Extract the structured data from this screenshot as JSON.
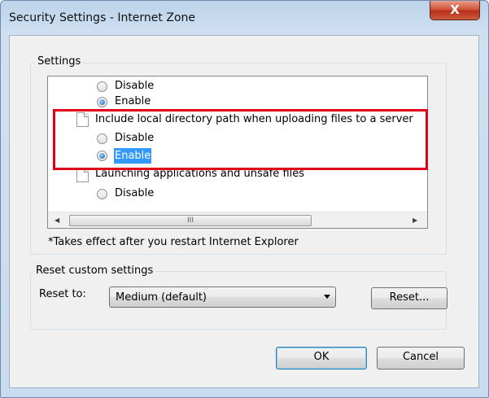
{
  "window": {
    "title": "Security Settings - Internet Zone",
    "close_glyph": "X"
  },
  "settings_group": {
    "label": "Settings",
    "rows": [
      {
        "type": "option",
        "label": "Disable",
        "checked": false
      },
      {
        "type": "option",
        "label": "Enable",
        "checked": true
      },
      {
        "type": "category",
        "label": "Include local directory path when uploading files to a server"
      },
      {
        "type": "option",
        "label": "Disable",
        "checked": false
      },
      {
        "type": "option",
        "label": "Enable",
        "checked": true,
        "selected": true
      },
      {
        "type": "category",
        "label": "Launching applications and unsafe files"
      },
      {
        "type": "option",
        "label": "Disable",
        "checked": false
      }
    ],
    "note": "*Takes effect after you restart Internet Explorer"
  },
  "reset_group": {
    "label": "Reset custom settings",
    "reset_to_label": "Reset to:",
    "select_value": "Medium (default)",
    "reset_button": "Reset..."
  },
  "buttons": {
    "ok": "OK",
    "cancel": "Cancel"
  },
  "scroll": {
    "thumb_grip": "III",
    "up_arrow": "▲",
    "left_arrow": "◀",
    "right_arrow": "▶"
  },
  "colors": {
    "highlight": "#e3001b",
    "selection": "#3399ff"
  }
}
